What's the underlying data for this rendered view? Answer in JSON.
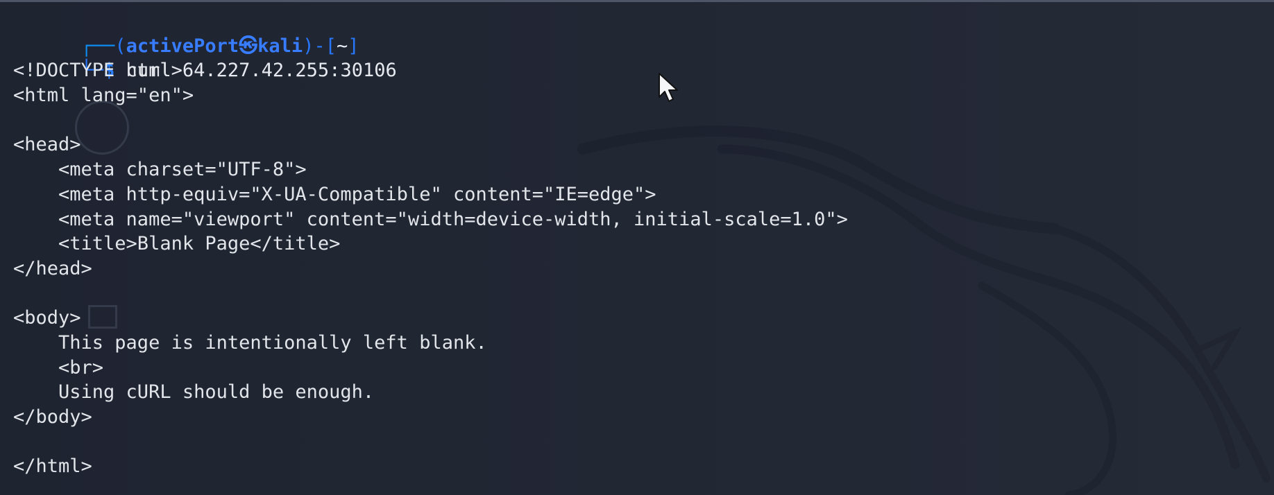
{
  "terminal": {
    "prompt": {
      "user": "activePort",
      "symbol": "㉿",
      "host": "kali",
      "cwd": "~"
    },
    "command": "curl 64.227.42.255:30106",
    "output_lines": [
      "<!DOCTYPE html>",
      "<html lang=\"en\">",
      "",
      "<head>",
      "    <meta charset=\"UTF-8\">",
      "    <meta http-equiv=\"X-UA-Compatible\" content=\"IE=edge\">",
      "    <meta name=\"viewport\" content=\"width=device-width, initial-scale=1.0\">",
      "    <title>Blank Page</title>",
      "</head>",
      "",
      "<body>",
      "    This page is intentionally left blank.",
      "    <br>",
      "    Using cURL should be enough.",
      "</body>",
      "",
      "</html>"
    ]
  }
}
